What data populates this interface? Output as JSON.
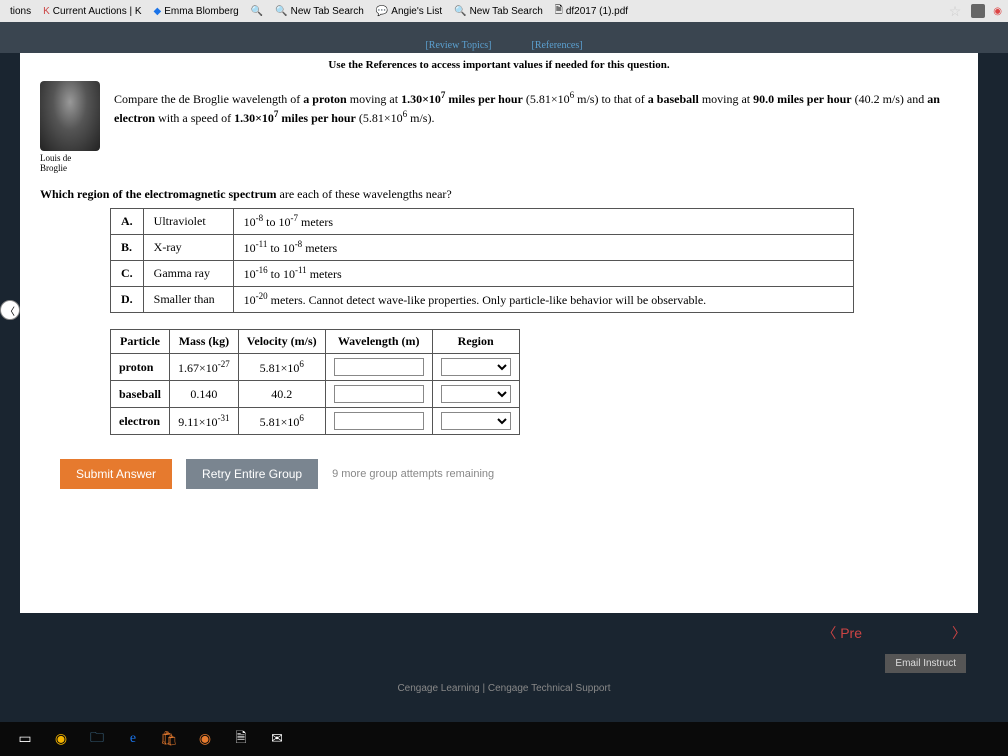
{
  "tabs": {
    "t0": "tions",
    "t1": "Current Auctions | K",
    "t2": "Emma Blomberg",
    "t3": "New Tab Search",
    "t4": "Angie's List",
    "t5": "New Tab Search",
    "t6": "df2017 (1).pdf"
  },
  "header": {
    "review": "[Review Topics]",
    "references": "[References]"
  },
  "instruction": "Use the References to access important values if needed for this question.",
  "scientist": "Louis de Broglie",
  "problem": {
    "p1a": "Compare the de Broglie wavelength of ",
    "p1b": "a proton",
    "p1c": " moving at ",
    "p1d": "1.30×10",
    "p1d_sup": "7",
    "p1e": " miles per hour",
    "p1f": " (5.81×10",
    "p1f_sup": "6",
    "p1g": " m/s) to that of ",
    "p1h": "a baseball",
    "p1i": " moving at ",
    "p1j": "90.0 miles per hour",
    "p2a": " (40.2 m/s) and ",
    "p2b": "an electron",
    "p2c": " with a speed of ",
    "p2d": "1.30×10",
    "p2d_sup": "7",
    "p2e": " miles per hour",
    "p2f": " (5.81×10",
    "p2f_sup": "6",
    "p2g": " m/s)."
  },
  "question": {
    "bold": "Which region of the electromagnetic spectrum",
    "rest": " are each of these wavelengths near?"
  },
  "spectrum": {
    "rows": [
      {
        "label": "A.",
        "name": "Ultraviolet",
        "r1": "10",
        "s1": "-8",
        "mid": " to 10",
        "s2": "-7",
        "end": " meters"
      },
      {
        "label": "B.",
        "name": "X-ray",
        "r1": "10",
        "s1": "-11",
        "mid": " to 10",
        "s2": "-8",
        "end": " meters"
      },
      {
        "label": "C.",
        "name": "Gamma ray",
        "r1": "10",
        "s1": "-16",
        "mid": " to 10",
        "s2": "-11",
        "end": " meters"
      },
      {
        "label": "D.",
        "name": "Smaller than",
        "r1": "10",
        "s1": "-20",
        "mid": "",
        "s2": "",
        "end": " meters. Cannot detect wave-like properties. Only particle-like behavior will be observable."
      }
    ]
  },
  "particle_table": {
    "h1": "Particle",
    "h2": "Mass (kg)",
    "h3": "Velocity (m/s)",
    "h4": "Wavelength (m)",
    "h5": "Region",
    "rows": [
      {
        "name": "proton",
        "m1": "1.67×10",
        "m1s": "-27",
        "v1": "5.81×10",
        "v1s": "6"
      },
      {
        "name": "baseball",
        "m1": "0.140",
        "m1s": "",
        "v1": "40.2",
        "v1s": ""
      },
      {
        "name": "electron",
        "m1": "9.11×10",
        "m1s": "-31",
        "v1": "5.81×10",
        "v1s": "6"
      }
    ]
  },
  "buttons": {
    "submit": "Submit Answer",
    "retry": "Retry Entire Group",
    "attempts": "9 more group attempts remaining"
  },
  "nav": {
    "prev": "〈 Pre",
    "next": "〉"
  },
  "email": "Email Instruct",
  "footer": "Cengage Learning  |  Cengage Technical Support"
}
